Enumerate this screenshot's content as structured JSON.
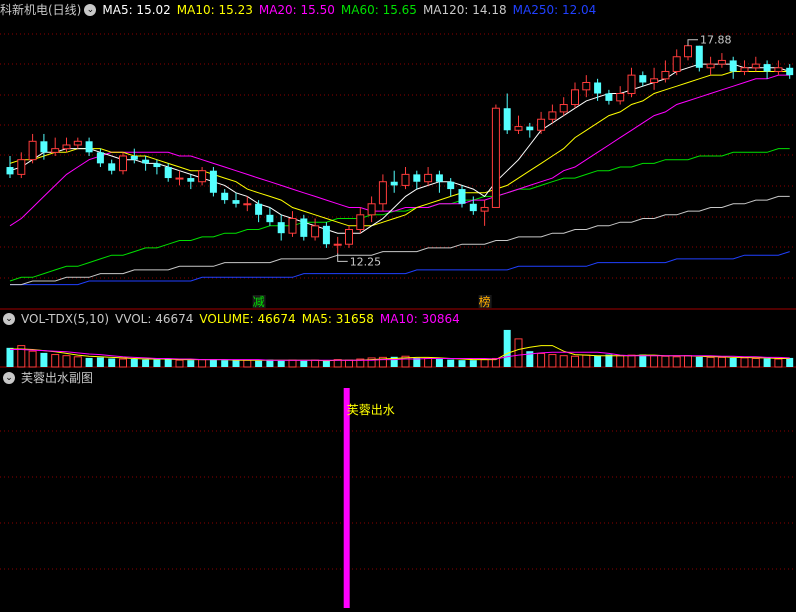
{
  "main_legend": {
    "stock": "科新机电(日线)",
    "ma5": "MA5: 15.02",
    "ma10": "MA10: 15.23",
    "ma20": "MA20: 15.50",
    "ma60": "MA60: 15.65",
    "ma120": "MA120: 14.18",
    "ma250": "MA250: 12.04",
    "high_label": "17.88",
    "low_label": "12.25",
    "tag_reduce": "减",
    "tag_list": "榜"
  },
  "vol_legend": {
    "name": "VOL-TDX(5,10)",
    "vvol": "VVOL: 46674",
    "volume": "VOLUME: 46674",
    "ma5": "MA5: 31658",
    "ma10": "MA10: 30864"
  },
  "sub_legend": {
    "name": "芙蓉出水副图",
    "signal_label": "芙蓉出水"
  },
  "colors": {
    "up": "#ff3c3c",
    "down": "#54ffff",
    "ma5": "#ffffff",
    "ma10": "#ffff00",
    "ma20": "#ff00ff",
    "ma60": "#00e000",
    "ma120": "#c8c8c8",
    "ma250": "#2040ff",
    "signal": "#ff00ff",
    "grid": "#8b0000"
  },
  "chart_data": [
    {
      "type": "candlestick",
      "title": "科新机电(日线)",
      "ylim": [
        11.2,
        18.6
      ],
      "high": 17.88,
      "low": 12.25,
      "candles": [
        [
          14.6,
          14.4,
          14.9,
          14.3
        ],
        [
          14.4,
          14.8,
          15.0,
          14.3
        ],
        [
          14.8,
          15.3,
          15.5,
          14.7
        ],
        [
          15.3,
          15.0,
          15.5,
          14.8
        ],
        [
          15.0,
          15.1,
          15.4,
          14.9
        ],
        [
          15.1,
          15.2,
          15.4,
          15.0
        ],
        [
          15.2,
          15.3,
          15.4,
          15.1
        ],
        [
          15.3,
          15.0,
          15.4,
          14.9
        ],
        [
          15.0,
          14.7,
          15.1,
          14.6
        ],
        [
          14.7,
          14.5,
          14.8,
          14.4
        ],
        [
          14.5,
          14.9,
          15.0,
          14.4
        ],
        [
          14.9,
          14.8,
          15.1,
          14.7
        ],
        [
          14.8,
          14.7,
          14.9,
          14.5
        ],
        [
          14.7,
          14.6,
          14.8,
          14.4
        ],
        [
          14.6,
          14.3,
          14.7,
          14.2
        ],
        [
          14.3,
          14.3,
          14.5,
          14.1
        ],
        [
          14.3,
          14.2,
          14.4,
          14.0
        ],
        [
          14.2,
          14.5,
          14.6,
          14.1
        ],
        [
          14.5,
          13.9,
          14.6,
          13.8
        ],
        [
          13.9,
          13.7,
          14.0,
          13.6
        ],
        [
          13.7,
          13.6,
          13.9,
          13.5
        ],
        [
          13.6,
          13.6,
          13.8,
          13.4
        ],
        [
          13.6,
          13.3,
          13.7,
          13.1
        ],
        [
          13.3,
          13.1,
          13.5,
          13.0
        ],
        [
          13.1,
          12.8,
          13.3,
          12.6
        ],
        [
          12.8,
          13.2,
          13.4,
          12.7
        ],
        [
          13.2,
          12.7,
          13.3,
          12.6
        ],
        [
          12.7,
          13.0,
          13.2,
          12.6
        ],
        [
          13.0,
          12.5,
          13.1,
          12.4
        ],
        [
          12.5,
          12.5,
          12.7,
          12.25
        ],
        [
          12.5,
          12.9,
          13.0,
          12.4
        ],
        [
          12.9,
          13.3,
          13.5,
          12.8
        ],
        [
          13.3,
          13.6,
          13.8,
          13.1
        ],
        [
          13.6,
          14.2,
          14.4,
          13.4
        ],
        [
          14.2,
          14.1,
          14.5,
          13.9
        ],
        [
          14.1,
          14.4,
          14.6,
          14.0
        ],
        [
          14.4,
          14.2,
          14.5,
          14.0
        ],
        [
          14.2,
          14.4,
          14.6,
          14.1
        ],
        [
          14.4,
          14.2,
          14.5,
          13.9
        ],
        [
          14.2,
          14.0,
          14.3,
          13.8
        ],
        [
          14.0,
          13.6,
          14.1,
          13.5
        ],
        [
          13.6,
          13.4,
          13.8,
          13.3
        ],
        [
          13.4,
          13.5,
          13.7,
          13.0
        ],
        [
          13.5,
          16.2,
          16.3,
          13.5
        ],
        [
          16.2,
          15.6,
          16.6,
          15.5
        ],
        [
          15.6,
          15.7,
          16.0,
          15.5
        ],
        [
          15.7,
          15.6,
          15.8,
          15.4
        ],
        [
          15.6,
          15.9,
          16.1,
          15.5
        ],
        [
          15.9,
          16.1,
          16.3,
          15.8
        ],
        [
          16.1,
          16.3,
          16.5,
          16.0
        ],
        [
          16.3,
          16.7,
          16.9,
          16.2
        ],
        [
          16.7,
          16.9,
          17.1,
          16.5
        ],
        [
          16.9,
          16.6,
          17.0,
          16.4
        ],
        [
          16.6,
          16.4,
          16.7,
          16.3
        ],
        [
          16.4,
          16.6,
          16.8,
          16.3
        ],
        [
          16.6,
          17.1,
          17.3,
          16.5
        ],
        [
          17.1,
          16.9,
          17.2,
          16.8
        ],
        [
          16.9,
          17.0,
          17.3,
          16.7
        ],
        [
          17.0,
          17.2,
          17.5,
          16.9
        ],
        [
          17.2,
          17.6,
          17.8,
          17.1
        ],
        [
          17.6,
          17.9,
          17.9,
          17.5
        ],
        [
          17.9,
          17.3,
          17.9,
          17.2
        ],
        [
          17.3,
          17.4,
          17.6,
          17.1
        ],
        [
          17.4,
          17.5,
          17.7,
          17.3
        ],
        [
          17.5,
          17.2,
          17.6,
          17.0
        ],
        [
          17.2,
          17.3,
          17.5,
          17.1
        ],
        [
          17.3,
          17.4,
          17.6,
          17.2
        ],
        [
          17.4,
          17.2,
          17.5,
          17.0
        ],
        [
          17.2,
          17.3,
          17.5,
          17.1
        ],
        [
          17.3,
          17.1,
          17.4,
          17.0
        ]
      ],
      "ma5": [
        14.5,
        14.6,
        14.8,
        15.0,
        15.0,
        15.1,
        15.1,
        15.1,
        15.0,
        14.9,
        14.8,
        14.8,
        14.7,
        14.7,
        14.6,
        14.5,
        14.4,
        14.3,
        14.2,
        14.1,
        13.9,
        13.8,
        13.6,
        13.5,
        13.3,
        13.2,
        13.1,
        13.0,
        12.9,
        12.8,
        12.8,
        12.8,
        13.0,
        13.2,
        13.5,
        13.8,
        14.0,
        14.1,
        14.2,
        14.2,
        14.1,
        14.0,
        13.8,
        14.2,
        14.5,
        14.8,
        15.2,
        15.6,
        15.8,
        16.0,
        16.2,
        16.4,
        16.5,
        16.6,
        16.6,
        16.7,
        16.8,
        16.9,
        17.0,
        17.2,
        17.3,
        17.4,
        17.4,
        17.4,
        17.4,
        17.3,
        17.3,
        17.3,
        17.3,
        17.2
      ],
      "ma10": [
        14.7,
        14.8,
        14.8,
        14.9,
        15.0,
        15.0,
        15.1,
        15.1,
        15.1,
        15.0,
        15.0,
        14.9,
        14.9,
        14.8,
        14.7,
        14.6,
        14.5,
        14.5,
        14.4,
        14.3,
        14.2,
        14.0,
        13.9,
        13.8,
        13.7,
        13.5,
        13.4,
        13.3,
        13.2,
        13.1,
        13.0,
        13.0,
        13.0,
        13.1,
        13.2,
        13.3,
        13.5,
        13.6,
        13.7,
        13.8,
        13.9,
        13.9,
        13.9,
        14.0,
        14.1,
        14.3,
        14.5,
        14.7,
        14.9,
        15.1,
        15.4,
        15.6,
        15.8,
        16.0,
        16.1,
        16.3,
        16.4,
        16.6,
        16.7,
        16.8,
        16.9,
        17.0,
        17.1,
        17.1,
        17.2,
        17.2,
        17.2,
        17.2,
        17.2,
        17.2
      ],
      "ma20": [
        13.0,
        13.2,
        13.5,
        13.8,
        14.1,
        14.4,
        14.6,
        14.8,
        14.9,
        15.0,
        15.0,
        15.0,
        15.0,
        15.0,
        15.0,
        14.9,
        14.9,
        14.8,
        14.7,
        14.6,
        14.5,
        14.4,
        14.3,
        14.2,
        14.1,
        14.0,
        13.9,
        13.8,
        13.7,
        13.6,
        13.5,
        13.5,
        13.4,
        13.4,
        13.4,
        13.5,
        13.5,
        13.5,
        13.6,
        13.6,
        13.6,
        13.7,
        13.7,
        13.8,
        13.9,
        14.0,
        14.1,
        14.2,
        14.3,
        14.5,
        14.6,
        14.8,
        15.0,
        15.2,
        15.4,
        15.6,
        15.8,
        16.0,
        16.1,
        16.3,
        16.4,
        16.5,
        16.6,
        16.7,
        16.8,
        16.9,
        17.0,
        17.0,
        17.1,
        17.1
      ],
      "ma60": [
        11.5,
        11.6,
        11.6,
        11.7,
        11.8,
        11.9,
        11.9,
        12.0,
        12.1,
        12.2,
        12.2,
        12.3,
        12.4,
        12.4,
        12.5,
        12.6,
        12.6,
        12.7,
        12.7,
        12.8,
        12.8,
        12.9,
        12.9,
        13.0,
        13.0,
        13.0,
        13.1,
        13.1,
        13.1,
        13.2,
        13.2,
        13.2,
        13.3,
        13.3,
        13.4,
        13.4,
        13.5,
        13.5,
        13.6,
        13.6,
        13.7,
        13.7,
        13.8,
        13.8,
        13.9,
        14.0,
        14.0,
        14.1,
        14.2,
        14.3,
        14.3,
        14.4,
        14.5,
        14.5,
        14.6,
        14.6,
        14.7,
        14.7,
        14.8,
        14.8,
        14.8,
        14.9,
        14.9,
        14.9,
        15.0,
        15.0,
        15.0,
        15.0,
        15.1,
        15.1
      ],
      "ma120": [
        11.4,
        11.4,
        11.5,
        11.5,
        11.5,
        11.6,
        11.6,
        11.6,
        11.7,
        11.7,
        11.7,
        11.8,
        11.8,
        11.8,
        11.8,
        11.9,
        11.9,
        11.9,
        11.9,
        12.0,
        12.0,
        12.0,
        12.0,
        12.0,
        12.1,
        12.1,
        12.1,
        12.1,
        12.1,
        12.2,
        12.2,
        12.2,
        12.2,
        12.3,
        12.3,
        12.3,
        12.3,
        12.4,
        12.4,
        12.4,
        12.5,
        12.5,
        12.5,
        12.6,
        12.6,
        12.7,
        12.7,
        12.7,
        12.8,
        12.8,
        12.9,
        12.9,
        13.0,
        13.0,
        13.1,
        13.1,
        13.2,
        13.2,
        13.3,
        13.3,
        13.4,
        13.4,
        13.5,
        13.5,
        13.6,
        13.6,
        13.7,
        13.7,
        13.8,
        13.8
      ],
      "ma250": [
        11.4,
        11.4,
        11.4,
        11.4,
        11.4,
        11.4,
        11.4,
        11.5,
        11.5,
        11.5,
        11.5,
        11.5,
        11.5,
        11.5,
        11.5,
        11.5,
        11.5,
        11.6,
        11.6,
        11.6,
        11.6,
        11.6,
        11.6,
        11.6,
        11.6,
        11.6,
        11.7,
        11.7,
        11.7,
        11.7,
        11.7,
        11.7,
        11.7,
        11.7,
        11.7,
        11.7,
        11.8,
        11.8,
        11.8,
        11.8,
        11.8,
        11.8,
        11.8,
        11.8,
        11.8,
        11.9,
        11.9,
        11.9,
        11.9,
        11.9,
        11.9,
        11.9,
        12.0,
        12.0,
        12.0,
        12.0,
        12.0,
        12.0,
        12.0,
        12.1,
        12.1,
        12.1,
        12.1,
        12.1,
        12.1,
        12.2,
        12.2,
        12.2,
        12.2,
        12.3
      ]
    },
    {
      "type": "bar",
      "title": "VOL-TDX(5,10)",
      "ylim": [
        0,
        75000
      ],
      "values": [
        36000,
        40000,
        30000,
        27000,
        24000,
        22000,
        20000,
        18000,
        19000,
        17000,
        16000,
        16000,
        15000,
        15000,
        17000,
        14000,
        14000,
        15000,
        16000,
        14000,
        14000,
        14000,
        13000,
        15000,
        13000,
        14000,
        13000,
        14000,
        13000,
        15000,
        14000,
        16000,
        18000,
        19000,
        20000,
        21000,
        18000,
        17000,
        16000,
        15000,
        14000,
        14000,
        15000,
        17000,
        68000,
        52000,
        30000,
        26000,
        24000,
        22000,
        21000,
        23000,
        22000,
        24000,
        22000,
        23000,
        24000,
        22000,
        21000,
        20000,
        22000,
        20000,
        19000,
        19000,
        18000,
        18000,
        17000,
        17000,
        16000,
        18000
      ],
      "ma5": [
        34000,
        34000,
        33000,
        31000,
        29000,
        26000,
        23000,
        21000,
        20000,
        19000,
        18000,
        17000,
        16000,
        16000,
        16000,
        15000,
        15000,
        15000,
        15000,
        15000,
        14000,
        14000,
        14000,
        14000,
        14000,
        14000,
        14000,
        14000,
        13000,
        14000,
        14000,
        14000,
        15000,
        16000,
        17000,
        18000,
        19000,
        19000,
        18000,
        17000,
        16000,
        15000,
        15000,
        15000,
        26000,
        33000,
        37000,
        40000,
        40000,
        30000,
        24000,
        23000,
        22000,
        22000,
        22000,
        22000,
        23000,
        23000,
        22000,
        22000,
        22000,
        21000,
        20000,
        20000,
        19000,
        19000,
        18000,
        18000,
        17000,
        17000
      ],
      "ma10": [
        33000,
        33000,
        32000,
        31000,
        30000,
        29000,
        27000,
        25000,
        24000,
        22000,
        20000,
        19000,
        18000,
        17000,
        17000,
        16000,
        16000,
        15000,
        15000,
        15000,
        15000,
        15000,
        15000,
        14000,
        14000,
        14000,
        14000,
        14000,
        14000,
        14000,
        14000,
        14000,
        14000,
        15000,
        15000,
        16000,
        16000,
        17000,
        17000,
        17000,
        17000,
        17000,
        17000,
        16000,
        20000,
        23000,
        25000,
        27000,
        28000,
        28000,
        28000,
        28000,
        28000,
        26000,
        23000,
        22000,
        22000,
        22000,
        22000,
        22000,
        22000,
        22000,
        22000,
        21000,
        21000,
        20000,
        20000,
        19000,
        19000,
        18000
      ]
    },
    {
      "type": "bar",
      "title": "芙蓉出水副图",
      "ylim": [
        0,
        1
      ],
      "signal_index": 29,
      "values": [
        0,
        0,
        0,
        0,
        0,
        0,
        0,
        0,
        0,
        0,
        0,
        0,
        0,
        0,
        0,
        0,
        0,
        0,
        0,
        0,
        0,
        0,
        0,
        0,
        0,
        0,
        0,
        0,
        0,
        1,
        0,
        0,
        0,
        0,
        0,
        0,
        0,
        0,
        0,
        0,
        0,
        0,
        0,
        0,
        0,
        0,
        0,
        0,
        0,
        0,
        0,
        0,
        0,
        0,
        0,
        0,
        0,
        0,
        0,
        0,
        0,
        0,
        0,
        0,
        0,
        0,
        0,
        0,
        0,
        0
      ]
    }
  ]
}
